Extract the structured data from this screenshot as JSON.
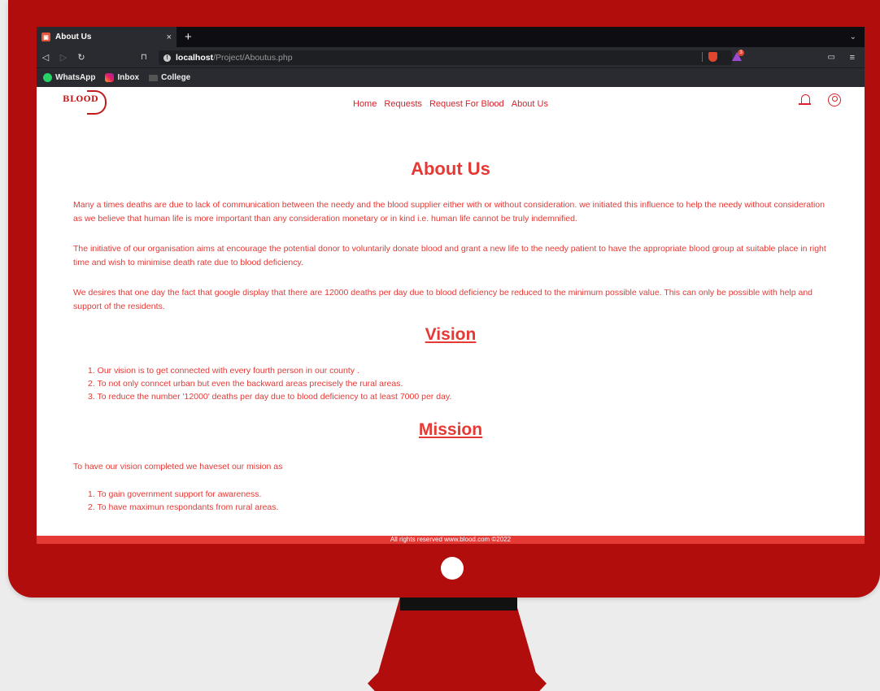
{
  "browser": {
    "tab_title": "About Us",
    "tab_close": "×",
    "new_tab": "+",
    "tab_menu": "⌄",
    "url_host": "localhost",
    "url_path": "/Project/Aboutus.php",
    "rewards_count": "3",
    "bookmarks": [
      "WhatsApp",
      "Inbox",
      "College"
    ]
  },
  "site": {
    "logo": "BLOOD",
    "nav": [
      "Home",
      "Requests",
      "Request For Blood",
      "About Us"
    ]
  },
  "about": {
    "title": "About Us",
    "p1": "Many a times deaths are due to lack of communication between the needy and the blood supplier either with or without consideration. we initiated this influence to help the needy without consideration as we believe that human life is more important than any consideration monetary or in kind i.e. human life cannot be truly indemnified.",
    "p2": "The initiative of our organisation aims at encourage the potential donor to voluntarily donate blood and grant a new life to the needy patient to have the appropriate blood group at suitable place in right time and wish to minimise death rate due to blood deficiency.",
    "p3": "We desires that one day the fact that google display that there are 12000 deaths per day due to blood deficiency be reduced to the minimum possible value. This can only be possible with help and support of the residents."
  },
  "vision": {
    "title": "Vision",
    "items": [
      "1. Our vision is to get connected with every fourth person in our county .",
      "2. To not only conncet urban but even the backward areas precisely the rural areas.",
      "3. To reduce the number '12000' deaths per day due to blood deficiency to at least 7000 per day."
    ]
  },
  "mission": {
    "title": "Mission",
    "intro": "To have our vision completed we haveset our mision as",
    "items": [
      "1. To gain government support for awareness.",
      "2. To have maximun respondants from rural areas."
    ]
  },
  "footer": "All rights reserved www.blood.com ©2022"
}
